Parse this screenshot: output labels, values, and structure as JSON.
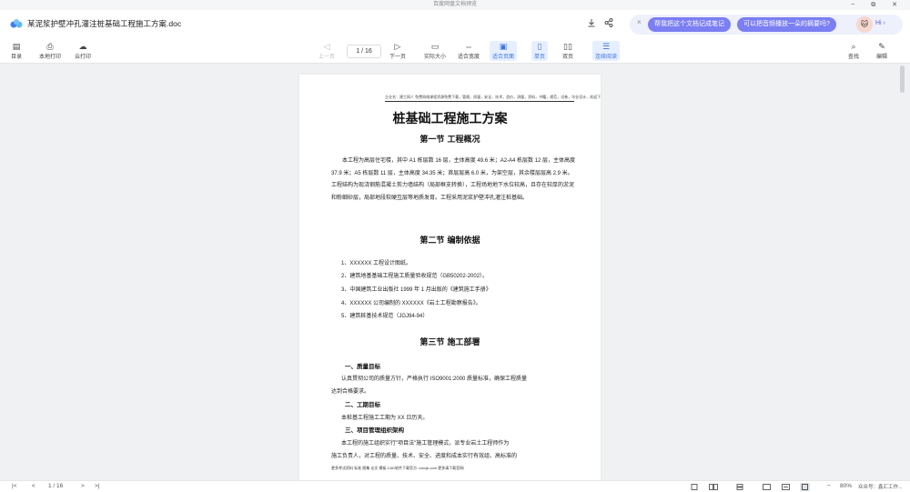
{
  "window": {
    "title": "百度网盘文档预览",
    "controls": "− ⧉ ✕"
  },
  "header": {
    "doc_title": "某泥浆护壁冲孔灌注桩基础工程施工方案.doc",
    "download_icon": "download-icon",
    "share_icon": "share-icon"
  },
  "ai_bar": {
    "close": "×",
    "pill1": "帮我把这个文档记成笔记",
    "pill2": "可以把音频播放一朵的摘要吗?",
    "greeting": "Hi ›",
    "avatar": "🐱"
  },
  "toolbar": {
    "toc_icon": "▤",
    "toc": "目录",
    "local_print_icon": "⎙",
    "local_print": "本地打印",
    "cloud_print_icon": "☁",
    "cloud_print": "云打印",
    "prev_icon": "◁",
    "prev": "上一页",
    "page_indicator": "1 / 16",
    "next_icon": "▷",
    "next": "下一页",
    "actual_size_icon": "▭",
    "actual_size": "实际大小",
    "fit_width_icon": "⇔",
    "fit_width": "适合宽度",
    "fit_page_icon": "▣",
    "fit_page": "适合页面",
    "single_page_icon": "▯",
    "single_page": "单页",
    "double_page_icon": "▯▯",
    "double_page": "双页",
    "continuous_icon": "☰",
    "continuous": "连续阅读",
    "search_icon": "⌕",
    "search": "查找",
    "edit_icon": "✎",
    "edit": "编辑"
  },
  "document": {
    "header_note": "企业名：建工网人 免费网络课程资源免费下载，管理，质量，安全，技术，造价，测量，资料，书籍，规范，试卷，毕业设计，欢迎下载阅读！",
    "title": "桩基础工程施工方案",
    "section1": "第一节    工程概况",
    "section1_text": "本工程为高层住宅楼，其中 A1 栋层数 16 层，主体高度 49.6 米；A2-A4 栋层数 12 层，主体高度 37.9 米；A5 栋层数 11 层，主体高度 34.35 米；首层层高 6.0 米，为架空层，其余楼层层高 2.9 米。工程结构为现浇钢筋混凝土剪力墙结构（局部框支转换），工程场地地下水位较高，且存在较厚的淤泥和粉细砂层，局部地段软硬互层等地质发育。工程采用泥浆护壁冲孔灌注桩基础。",
    "section2": "第二节    编制依据",
    "basis": [
      "1、XXXXXX 工程设计图纸。",
      "2、建筑地基基础工程施工质量验收规范（GB50202-2002）。",
      "3、中国建筑工业出版社 1999 年 1 月出版的《建筑施工手册》",
      "4、XXXXXX 公司编制的 XXXXXX《岩土工程勘察报告》。",
      "5、建筑桩基技术规范（JGJ94-94）"
    ],
    "section3": "第三节    施工部署",
    "sub1": "一、质量目标",
    "sub1_text1": "认真贯彻公司的质量方针，严格执行 ISO9001:2000 质量标准，确保工程质量",
    "sub1_text2": "达到合格要求。",
    "sub2": "二、工期目标",
    "sub2_text": "本桩基工程施工工期为 XX 日历天。",
    "sub3": "三、项目管理组织架构",
    "sub3_text1": "本工程的施工组织实行\"项目法\"施工管理模式，派专业岩土工程师作为",
    "sub3_text2": "施工负责人，对工程的质量、技术、安全、进度和成本实行有效组、高标准的",
    "footnote": "更多考试资料 标准 图集 论文 模板 CAD软件下载官方: vdccjk.com 更多请下载官网!"
  },
  "statusbar": {
    "first": "|<",
    "prev": "<",
    "page": "1 / 16",
    "next": ">",
    "last": ">|",
    "zoom_minus": "−",
    "zoom": "80%",
    "zoom_plus": "+",
    "watermark": "众众号：鑫汇工作..."
  }
}
